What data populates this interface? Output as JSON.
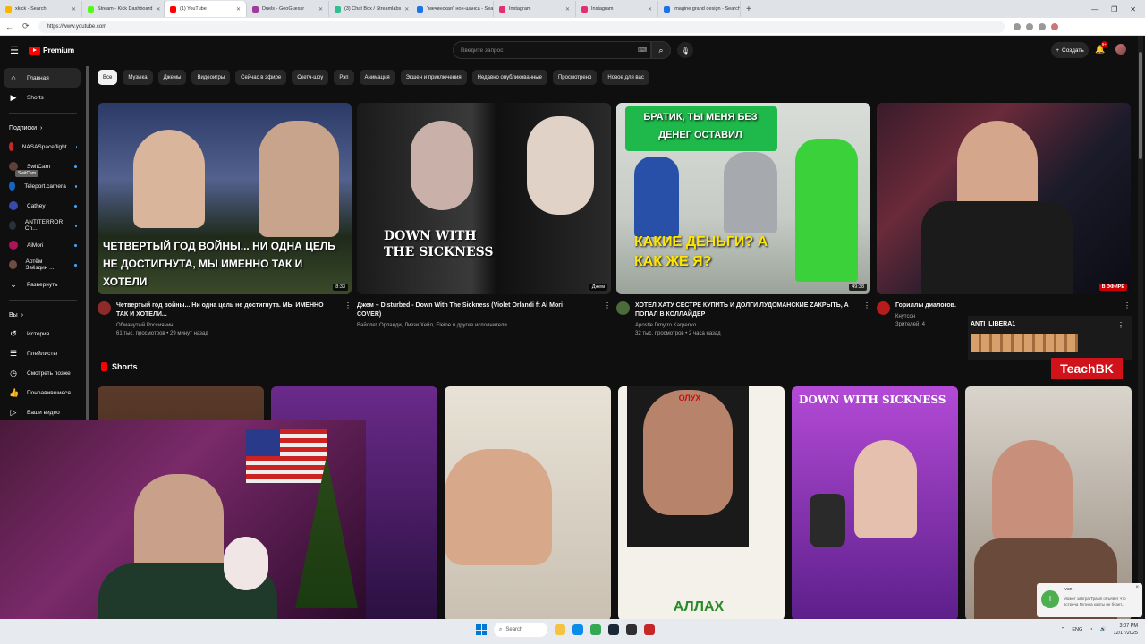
{
  "browser": {
    "tabs": [
      {
        "label": "xkick - Search",
        "color": "#f7b500"
      },
      {
        "label": "Stream - Kick Dashboard",
        "color": "#53fc18"
      },
      {
        "label": "(1) YouTube",
        "color": "#ff0000",
        "active": true
      },
      {
        "label": "Duels - GeoGuessr",
        "color": "#a13a9a"
      },
      {
        "label": "(3) Chat Box / Streamlabs",
        "color": "#2ec08f"
      },
      {
        "label": "\"мечинская\" нон-шанса - Search",
        "color": "#1a73e8"
      },
      {
        "label": "Instagram",
        "color": "#e1306c"
      },
      {
        "label": "Instagram",
        "color": "#e1306c"
      },
      {
        "label": "imagine grand design - Search",
        "color": "#1a73e8"
      }
    ],
    "new_tab": "+",
    "url": "https://www.youtube.com",
    "nav": {
      "back": "←",
      "reload": "⟳"
    },
    "window_controls": [
      "—",
      "❐",
      "✕"
    ]
  },
  "youtube": {
    "logo_text": "Premium",
    "search_placeholder": "Введите запрос",
    "create_label": "Создать",
    "notification_count": "9+",
    "chips": [
      "Все",
      "Музыка",
      "Джемы",
      "Видеоигры",
      "Сейчас в эфире",
      "Скетч-шоу",
      "Рэп",
      "Анимация",
      "Экшен и приключения",
      "Недавно опубликованные",
      "Просмотрено",
      "Новое для вас"
    ],
    "sidebar": {
      "home": "Главная",
      "shorts": "Shorts",
      "subscriptions_header": "Подписки",
      "subscriptions": [
        {
          "name": "NASASpaceflight",
          "color": "#c62828"
        },
        {
          "name": "SwitCam",
          "color": "#5d4037"
        },
        {
          "name": "Teleport.camera",
          "color": "#1565c0"
        },
        {
          "name": "Cathey",
          "color": "#3949ab"
        },
        {
          "name": "ANTITERROR Ch...",
          "color": "#263238"
        },
        {
          "name": "AiMori",
          "color": "#ad1457"
        },
        {
          "name": "Артём Звёздин ...",
          "color": "#6d4c41"
        }
      ],
      "expand": "Развернуть",
      "you_header": "Вы",
      "you_items": [
        "История",
        "Плейлисты",
        "Смотреть позже",
        "Понравившиеся",
        "Ваши видео"
      ],
      "tooltip": "SwitCam"
    },
    "videos": [
      {
        "caption": "ЧЕТВЕРТЫЙ ГОД ВОЙНЫ... НИ ОДНА ЦЕЛЬ НЕ ДОСТИГНУТА, МЫ ИМЕННО ТАК И ХОТЕЛИ",
        "duration": "8:33",
        "title": "Четвертый год войны... Ни одна цель не достигнута. МЫ ИМЕННО ТАК И ХОТЕЛИ...",
        "channel": "Обманутый Россиянин",
        "stats": "61 тыс. просмотров • 29 минут назад",
        "avatar_color": "#8d2b2b"
      },
      {
        "caption": "DOWN WITH THE SICKNESS",
        "duration": "Джем",
        "title": "Джем – Disturbed - Down With The Sickness (Violet Orlandi ft Ai Mori COVER)",
        "channel": "Вайолет Орланди, Лиззи Хейл, Eleine и другие исполнители",
        "stats": "",
        "avatar_color": "#444444"
      },
      {
        "caption": "БРАТИК, ТЫ МЕНЯ БЕЗ ДЕНЕГ ОСТАВИЛ",
        "caption2": "КАКИЕ ДЕНЬГИ? А КАК ЖЕ Я?",
        "duration": "49:38",
        "title": "ХОТЕЛ ХАТУ СЕСТРЕ КУПИТЬ И ДОЛГИ ЛУДОМАНСКИЕ ZАКРЫТЬ, А ПОПАЛ В КОЛЛАЙДЕР",
        "channel": "Apostle Dmytro Karpenko",
        "stats": "32 тыс. просмотров • 2 часа назад",
        "avatar_color": "#4b6b3a"
      },
      {
        "caption": "",
        "duration": "В ЭФИРЕ",
        "title": "Гориллы диалогов.",
        "channel": "Кнутсон",
        "stats": "Зрителей: 4",
        "avatar_color": "#b71c1c"
      }
    ],
    "shorts_header": "Shorts",
    "shorts_texts": {
      "s4_top": "ОЛУХ",
      "s4_bottom": "АЛЛАХ",
      "s5": "DOWN WITH SICKNESS"
    }
  },
  "overlay": {
    "chat_name": "ANTI_LIBERA1",
    "teachbk": "TeachBK",
    "notification": {
      "avatar": "I",
      "title": "Ivan",
      "body": "Может завтра Трамп объявит что встреча Путина карты не будет..."
    }
  },
  "taskbar": {
    "search": "Search",
    "tray": "ENG",
    "time": "3:07 PM",
    "date": "12/17/2025"
  }
}
